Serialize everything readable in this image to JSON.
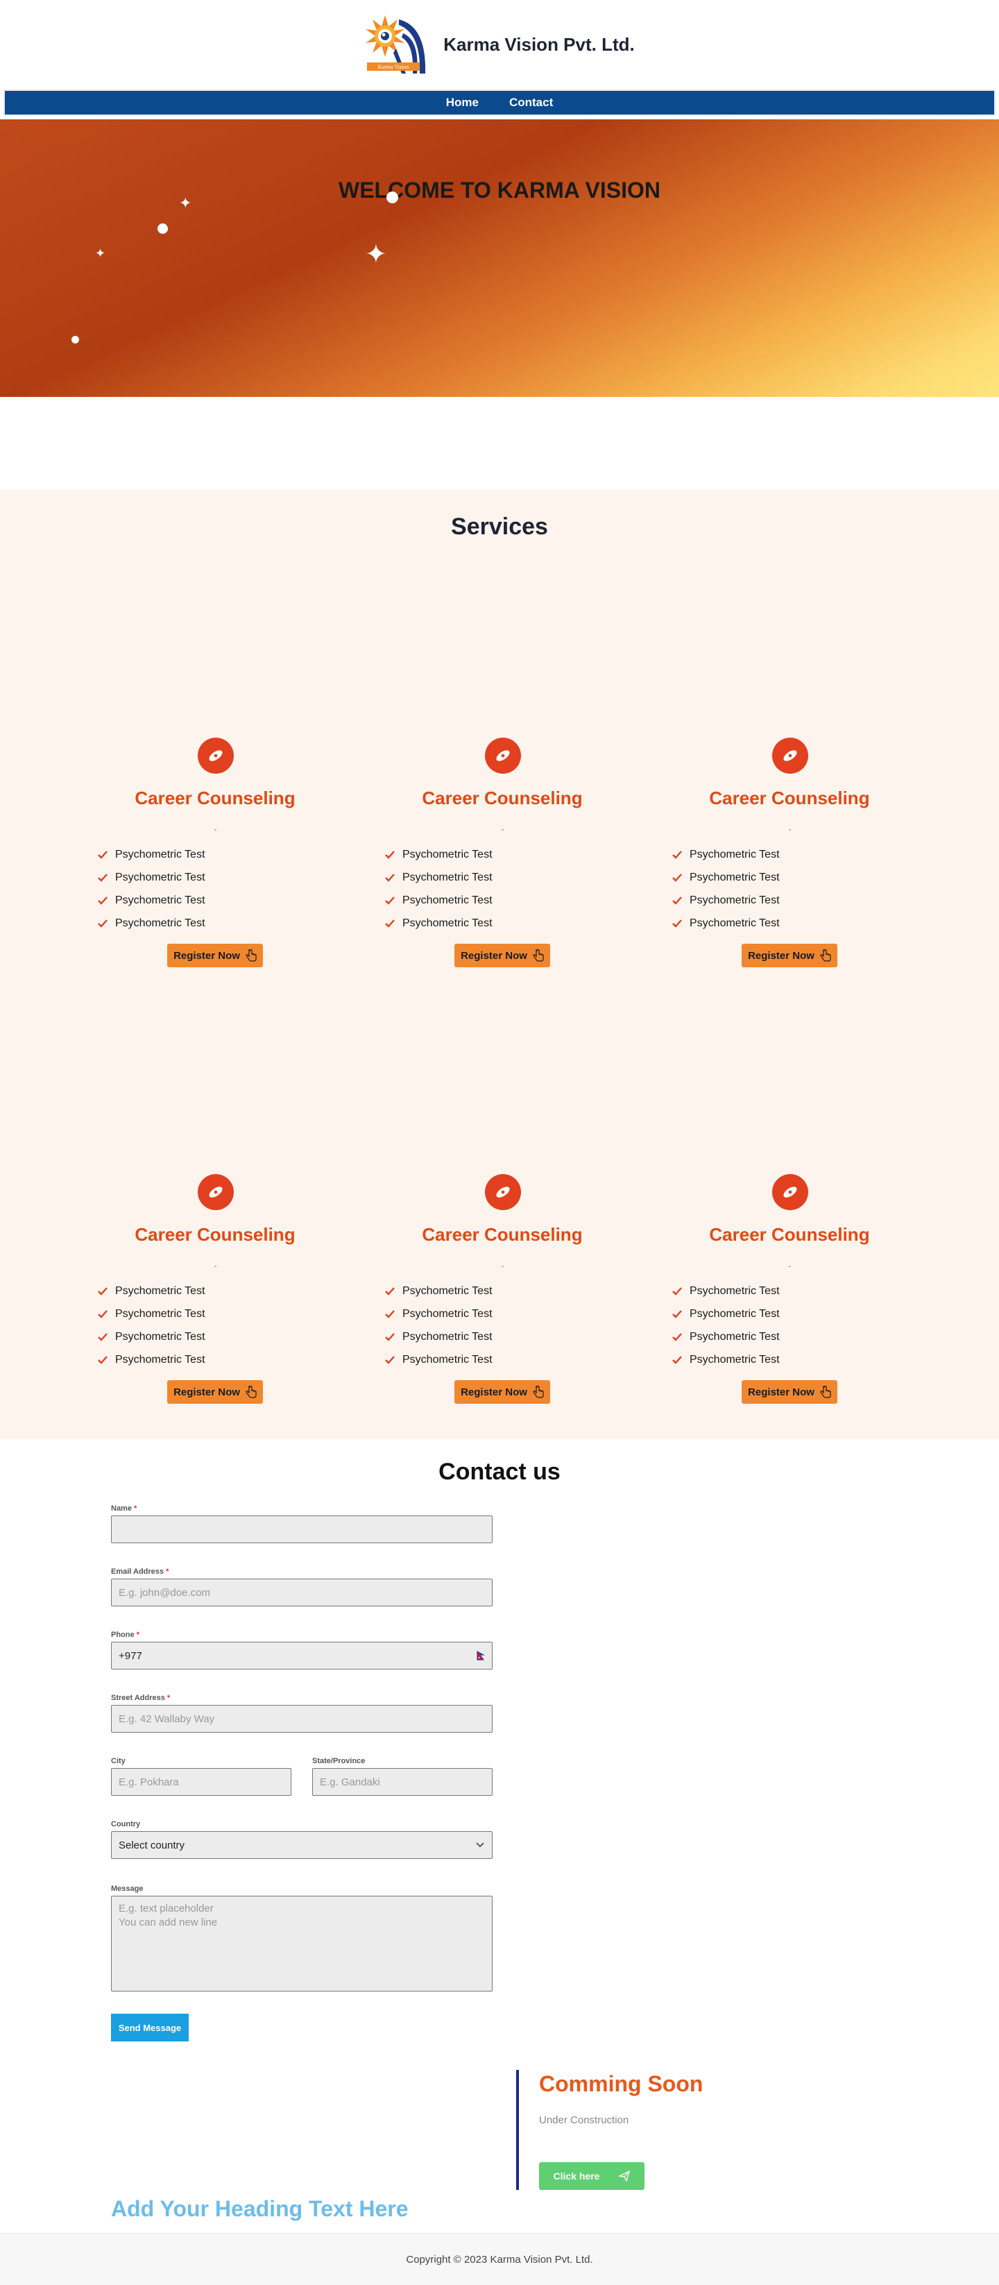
{
  "header": {
    "brand_name": "Karma Vision Pvt. Ltd.",
    "logo_text": "Karma Vision"
  },
  "nav": {
    "items": [
      {
        "label": "Home"
      },
      {
        "label": "Contact"
      }
    ]
  },
  "hero": {
    "title": "WELCOME TO KARMA VISION"
  },
  "services": {
    "title": "Services",
    "cards": [
      {
        "title": "Career Counseling",
        "items": [
          "Psychometric Test",
          "Psychometric Test",
          "Psychometric Test",
          "Psychometric Test"
        ],
        "button": "Register Now"
      },
      {
        "title": "Career Counseling",
        "items": [
          "Psychometric Test",
          "Psychometric Test",
          "Psychometric Test",
          "Psychometric Test"
        ],
        "button": "Register Now"
      },
      {
        "title": "Career Counseling",
        "items": [
          "Psychometric Test",
          "Psychometric Test",
          "Psychometric Test",
          "Psychometric Test"
        ],
        "button": "Register Now"
      },
      {
        "title": "Career Counseling",
        "items": [
          "Psychometric Test",
          "Psychometric Test",
          "Psychometric Test",
          "Psychometric Test"
        ],
        "button": "Register Now"
      },
      {
        "title": "Career Counseling",
        "items": [
          "Psychometric Test",
          "Psychometric Test",
          "Psychometric Test",
          "Psychometric Test"
        ],
        "button": "Register Now"
      },
      {
        "title": "Career Counseling",
        "items": [
          "Psychometric Test",
          "Psychometric Test",
          "Psychometric Test",
          "Psychometric Test"
        ],
        "button": "Register Now"
      }
    ]
  },
  "contact": {
    "title": "Contact us",
    "name": {
      "label": "Name",
      "value": ""
    },
    "email": {
      "label": "Email Address",
      "placeholder": "E.g. john@doe.com"
    },
    "phone": {
      "label": "Phone",
      "value": "+977"
    },
    "street": {
      "label": "Street Address",
      "placeholder": "E.g. 42 Wallaby Way"
    },
    "city": {
      "label": "City",
      "placeholder": "E.g. Pokhara"
    },
    "state": {
      "label": "State/Province",
      "placeholder": "E.g. Gandaki"
    },
    "country": {
      "label": "Country",
      "selected": "Select country"
    },
    "message": {
      "label": "Message",
      "placeholder": "E.g. text placeholder\nYou can add new line"
    },
    "submit": "Send Message"
  },
  "coming_soon": {
    "title": "Comming Soon",
    "subtitle": "Under Construction",
    "button": "Click here"
  },
  "extra_heading": "Add Your Heading Text Here",
  "footer": {
    "copyright": "Copyright © 2023 Karma Vision Pvt. Ltd."
  },
  "colors": {
    "nav": "#0b4a8c",
    "accent_orange": "#e04a15",
    "button_orange": "#f0872f",
    "send_blue": "#1a9fe0",
    "click_green": "#5fcf72",
    "services_bg": "#fef4ee"
  }
}
